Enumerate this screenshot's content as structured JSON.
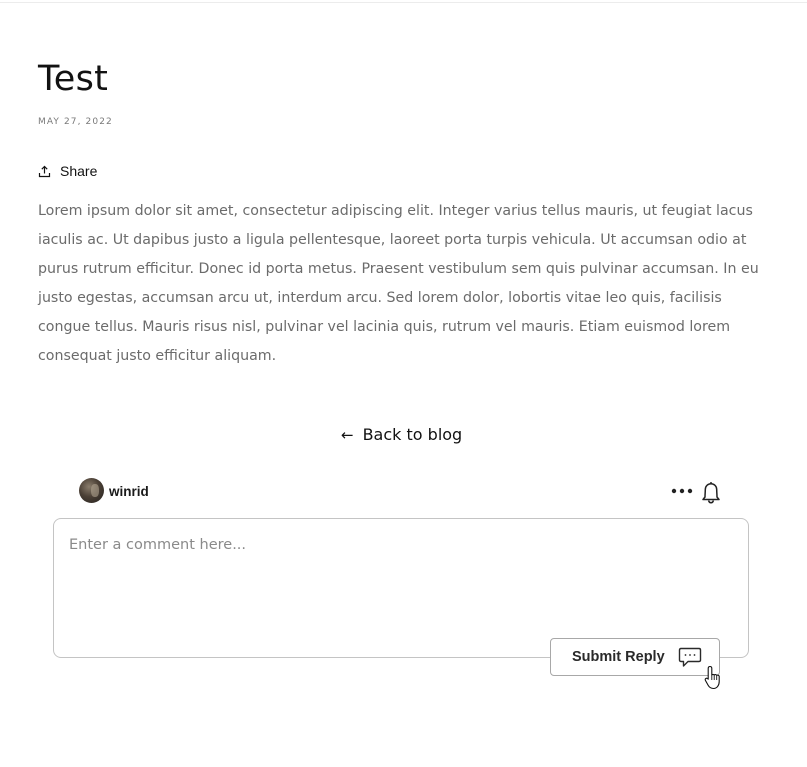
{
  "article": {
    "title": "Test",
    "date": "MAY 27, 2022",
    "share_label": "Share",
    "body": "Lorem ipsum dolor sit amet, consectetur adipiscing elit. Integer varius tellus mauris, ut feugiat lacus iaculis ac. Ut dapibus justo a ligula pellentesque, laoreet porta turpis vehicula. Ut accumsan odio at purus rutrum efficitur. Donec id porta metus. Praesent vestibulum sem quis pulvinar accumsan. In eu justo egestas, accumsan arcu ut, interdum arcu. Sed lorem dolor, lobortis vitae leo quis, facilisis congue tellus. Mauris risus nisl, pulvinar vel lacinia quis, rutrum vel mauris. Etiam euismod lorem consequat justo efficitur aliquam.",
    "back_label": "Back to blog",
    "back_arrow": "←"
  },
  "comments": {
    "username": "winrid",
    "input_placeholder": "Enter a comment here...",
    "submit_label": "Submit Reply",
    "icons": {
      "share": "share-icon",
      "more": "more-options-icon",
      "bell": "bell-icon",
      "chat": "chat-bubble-icon",
      "cursor": "hand-pointer-cursor"
    }
  },
  "colors": {
    "text_primary": "#121212",
    "text_muted": "#6b6b6b",
    "border": "#c4c4c4"
  }
}
